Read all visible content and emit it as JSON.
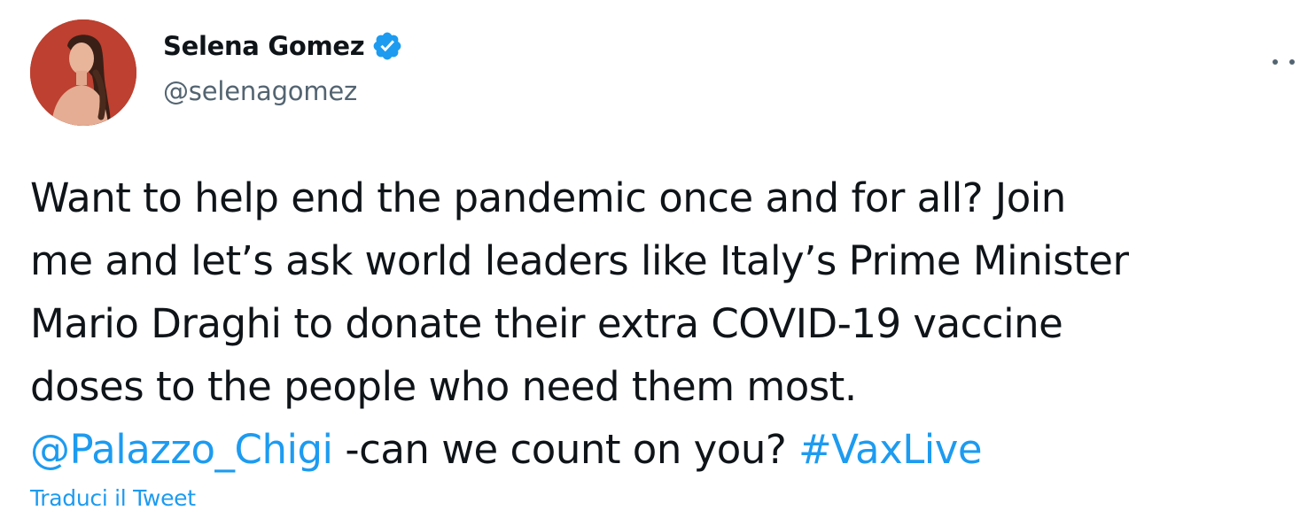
{
  "author": {
    "display_name": "Selena Gomez",
    "handle": "@selenagomez",
    "verified": true,
    "avatar_icon": "profile-photo"
  },
  "menu": {
    "more_icon": "more-horizontal-icon"
  },
  "tweet": {
    "lines": [
      "Want to help end the pandemic once and for all? Join",
      "me and let’s ask world leaders like Italy’s Prime Minister",
      "Mario Draghi to donate their extra COVID-19 vaccine",
      "doses to the people who need them most."
    ],
    "mention": "@Palazzo_Chigi",
    "middle_text": " -can we count on you? ",
    "hashtag": "#VaxLive"
  },
  "actions": {
    "translate_label": "Traduci il Tweet"
  },
  "colors": {
    "link": "#1d9bf0",
    "text": "#0f1419",
    "secondary": "#536471",
    "avatar_bg": "#b83a2c"
  }
}
